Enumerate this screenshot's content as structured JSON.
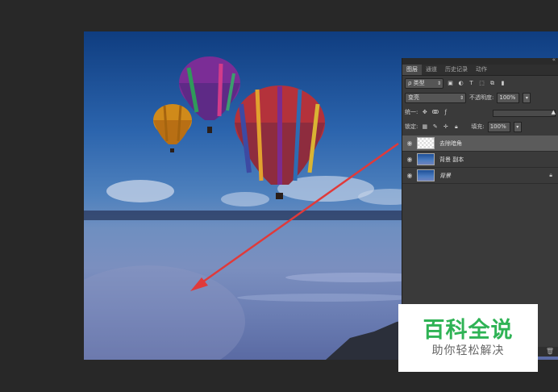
{
  "panel": {
    "tabs": [
      "图层",
      "通道",
      "历史记录",
      "动作"
    ],
    "kind_filter": "ρ 类型",
    "blend_mode": "变亮",
    "opacity_label": "不透明度:",
    "opacity_value": "100%",
    "unify_label": "统一:",
    "lock_label": "锁定:",
    "fill_label": "填充:",
    "fill_value": "100%",
    "layers": [
      {
        "name": "去除暗角",
        "selected": true
      },
      {
        "name": "背景 副本",
        "selected": false
      },
      {
        "name": "背景",
        "selected": false,
        "locked": true
      }
    ]
  },
  "watermark": {
    "title": "百科全说",
    "subtitle": "助你轻松解决",
    "title_color": "#2fb355"
  },
  "colors": {
    "annotation_arrow": "#e03a3a"
  },
  "icons": {
    "collapse": "double-chevron-icon",
    "eye": "eye-icon",
    "lock": "lock-icon",
    "trash": "trash-icon"
  }
}
